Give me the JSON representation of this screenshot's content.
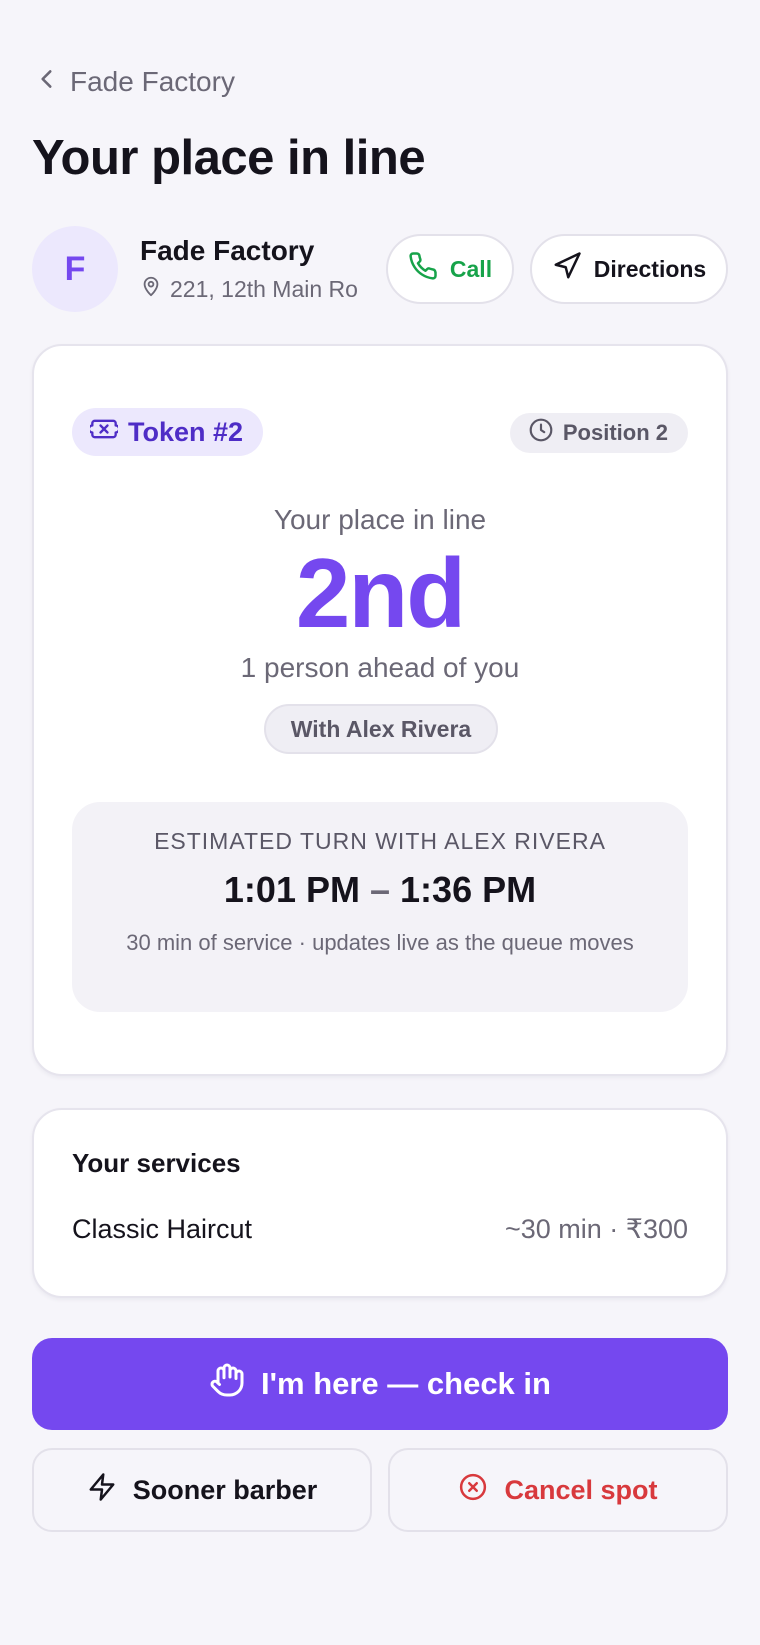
{
  "header": {
    "back_label": "Fade Factory",
    "title": "Your place in line"
  },
  "shop": {
    "initial": "F",
    "name": "Fade Factory",
    "address": "221, 12th Main Ro",
    "call_label": "Call",
    "directions_label": "Directions"
  },
  "queue": {
    "token_label": "Token #2",
    "position_label": "Position 2",
    "place_label": "Your place in line",
    "place_value": "2nd",
    "ahead_text": "1 person ahead of you",
    "barber_chip": "With Alex Rivera",
    "eta": {
      "label": "ESTIMATED TURN WITH ALEX RIVERA",
      "start": "1:01 PM",
      "separator": "–",
      "end": "1:36 PM",
      "note": "30 min of service · updates live as the queue moves"
    }
  },
  "services": {
    "title": "Your services",
    "items": [
      {
        "name": "Classic Haircut",
        "meta": "~30 min · ₹300"
      }
    ]
  },
  "actions": {
    "checkin_label": "I'm here — check in",
    "sooner_label": "Sooner barber",
    "cancel_label": "Cancel spot"
  },
  "colors": {
    "accent": "#7548ef",
    "call_green": "#17a34a",
    "cancel_red": "#d8393d",
    "background": "#f6f5fa"
  },
  "icons": [
    "chevron-left-icon",
    "map-pin-icon",
    "phone-icon",
    "navigation-icon",
    "ticket-icon",
    "clock-icon",
    "hand-icon",
    "zap-icon",
    "x-circle-icon"
  ]
}
